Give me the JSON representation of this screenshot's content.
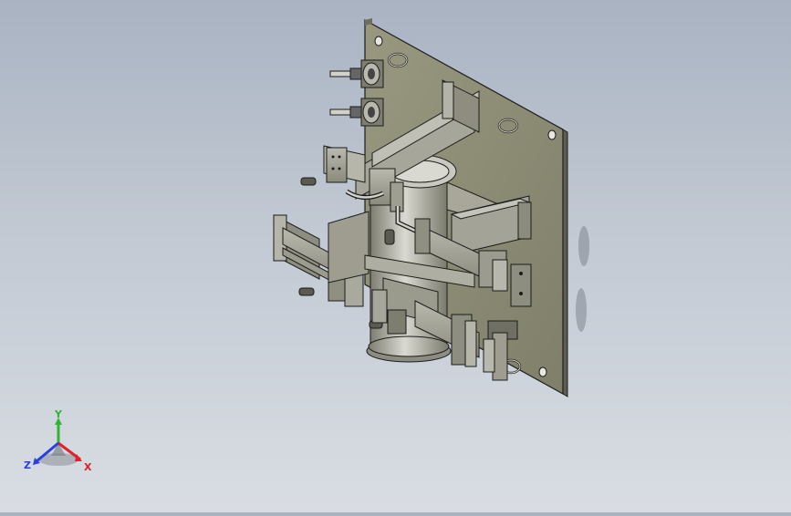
{
  "viewport": {
    "model_name": "",
    "colors": {
      "background_top": "#a9b3c2",
      "background_bottom": "#d9dde3",
      "plate": "#8e8d78",
      "plate_edge": "#5f5e4e",
      "metal": "#9c9c8c",
      "metal_light": "#c8c8c0",
      "outline": "#1c1c1c"
    }
  },
  "triad": {
    "x_label": "X",
    "y_label": "Y",
    "z_label": "Z",
    "colors": {
      "x": "#e0202a",
      "y": "#2fb52f",
      "z": "#2a3fe0"
    }
  }
}
